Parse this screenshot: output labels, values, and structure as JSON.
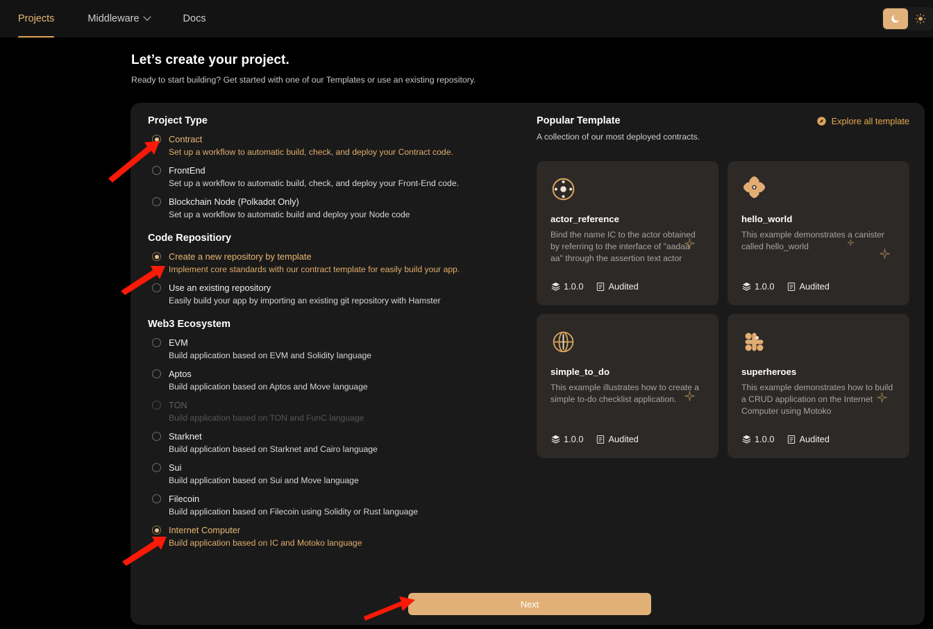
{
  "nav": {
    "items": [
      {
        "label": "Projects",
        "active": true,
        "caret": false
      },
      {
        "label": "Middleware",
        "active": false,
        "caret": true
      },
      {
        "label": "Docs",
        "active": false,
        "caret": false
      }
    ],
    "theme": {
      "dark_icon": "moon-icon",
      "light_icon": "sun-icon",
      "active": "dark"
    }
  },
  "header": {
    "title": "Let’s create your project.",
    "subtitle": "Ready to start building? Get started with one of our Templates or use an existing repository."
  },
  "project_type": {
    "title": "Project Type",
    "options": [
      {
        "label": "Contract",
        "desc": "Set up a workflow to automatic build, check, and deploy your Contract code.",
        "selected": true,
        "disabled": false
      },
      {
        "label": "FrontEnd",
        "desc": "Set up a workflow to automatic build, check, and deploy your Front-End code.",
        "selected": false,
        "disabled": false
      },
      {
        "label": "Blockchain Node (Polkadot Only)",
        "desc": "Set up a workflow to automatic build and deploy your Node code",
        "selected": false,
        "disabled": false
      }
    ]
  },
  "code_repository": {
    "title": "Code Repositiory",
    "options": [
      {
        "label": "Create a new repository by template",
        "desc": "Implement core standards with our contract template for easily build your app.",
        "selected": true,
        "disabled": false
      },
      {
        "label": "Use an existing repository",
        "desc": "Easily build your app by importing an existing git repository with Hamster",
        "selected": false,
        "disabled": false
      }
    ]
  },
  "web3_ecosystem": {
    "title": "Web3 Ecosystem",
    "options": [
      {
        "label": "EVM",
        "desc": "Build application based on EVM and Solidity language",
        "selected": false,
        "disabled": false
      },
      {
        "label": "Aptos",
        "desc": "Build application based on Aptos and Move language",
        "selected": false,
        "disabled": false
      },
      {
        "label": "TON",
        "desc": "Build application based on TON and FunC language",
        "selected": false,
        "disabled": true
      },
      {
        "label": "Starknet",
        "desc": "Build application based on Starknet and Cairo language",
        "selected": false,
        "disabled": false
      },
      {
        "label": "Sui",
        "desc": "Build application based on Sui and Move language",
        "selected": false,
        "disabled": false
      },
      {
        "label": "Filecoin",
        "desc": "Build application based on Filecoin using Solidity or Rust language",
        "selected": false,
        "disabled": false
      },
      {
        "label": "Internet Computer",
        "desc": "Build application based on IC and Motoko language",
        "selected": true,
        "disabled": false
      }
    ]
  },
  "templates": {
    "title": "Popular Template",
    "subtitle": "A collection of our most deployed contracts.",
    "explore_label": "Explore all template",
    "explore_icon": "compass-icon",
    "cards": [
      {
        "icon": "target-dot-icon",
        "name": "actor_reference",
        "desc": "Bind the name IC to the actor obtained by referring to the interface of \"aadaa aa\" through the assertion text actor",
        "version": "1.0.0",
        "audit": "Audited"
      },
      {
        "icon": "four-petal-icon",
        "name": "hello_world",
        "desc": "This example demonstrates a canister called hello_world",
        "version": "1.0.0",
        "audit": "Audited"
      },
      {
        "icon": "globe-icon",
        "name": "simple_to_do",
        "desc": "This example illustrates how to create a simple to-do checklist application.",
        "version": "1.0.0",
        "audit": "Audited"
      },
      {
        "icon": "molecule-icon",
        "name": "superheroes",
        "desc": "This example demonstrates how to build a CRUD application on the Internet Computer using Motoko",
        "version": "1.0.0",
        "audit": "Audited"
      }
    ],
    "meta_icons": {
      "version": "layers-icon",
      "audit": "document-icon"
    }
  },
  "footer": {
    "next_label": "Next"
  },
  "colors": {
    "accent": "#e0b076",
    "accent_text": "#e8b873",
    "explore_link": "#e8a94f",
    "panel_bg": "#1a1a1a",
    "card_bg": "#2c2927",
    "page_bg": "#000000",
    "topbar_bg": "#131313",
    "annotation_arrow": "#fb1908"
  }
}
